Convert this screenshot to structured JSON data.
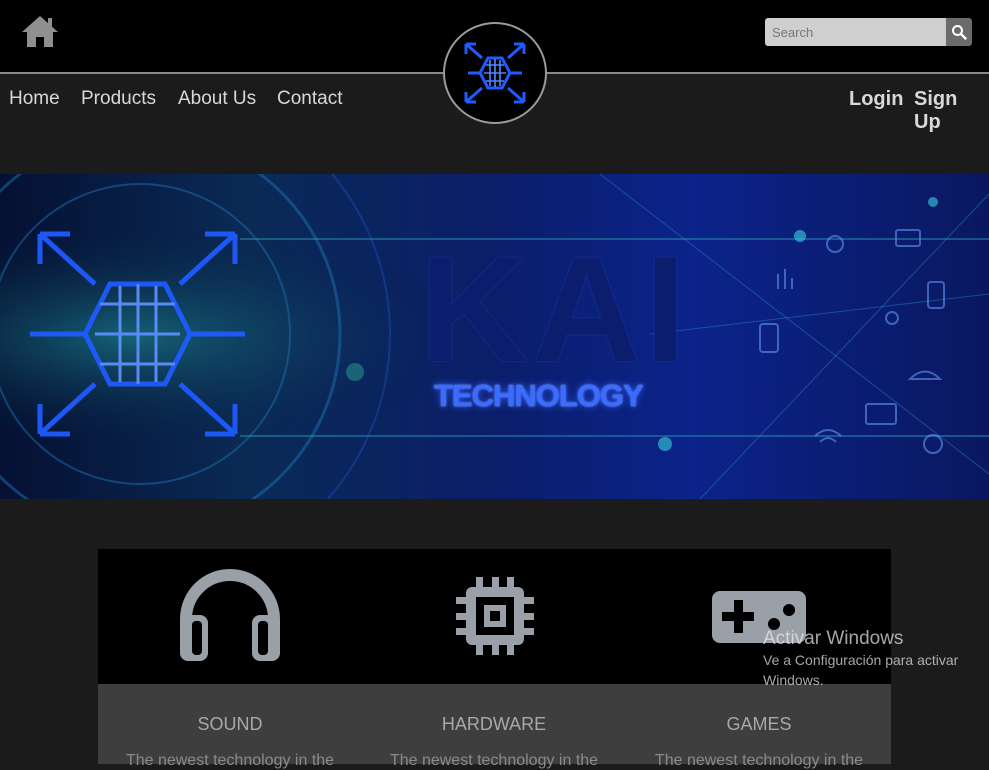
{
  "header": {
    "search_placeholder": "Search"
  },
  "nav": {
    "links": [
      "Home",
      "Products",
      "About Us",
      "Contact"
    ],
    "login": "Login",
    "signup": "Sign Up"
  },
  "banner": {
    "title": "KAI",
    "subtitle": "TECHNOLOGY"
  },
  "features": [
    {
      "icon": "headphones-icon",
      "title": "SOUND",
      "desc": "The newest technology in the"
    },
    {
      "icon": "cpu-chip-icon",
      "title": "HARDWARE",
      "desc": "The newest technology in the"
    },
    {
      "icon": "gamepad-icon",
      "title": "GAMES",
      "desc": "The newest technology in the"
    }
  ],
  "watermark": {
    "title": "Activar Windows",
    "line1": "Ve a Configuración para activar",
    "line2": "Windows."
  },
  "colors": {
    "topbar": "#000000",
    "page_bg": "#1b1b1b",
    "nav_text": "#d8d8d8",
    "icon_gray": "#9aa0a8",
    "banner_accent": "#3a6dff"
  }
}
